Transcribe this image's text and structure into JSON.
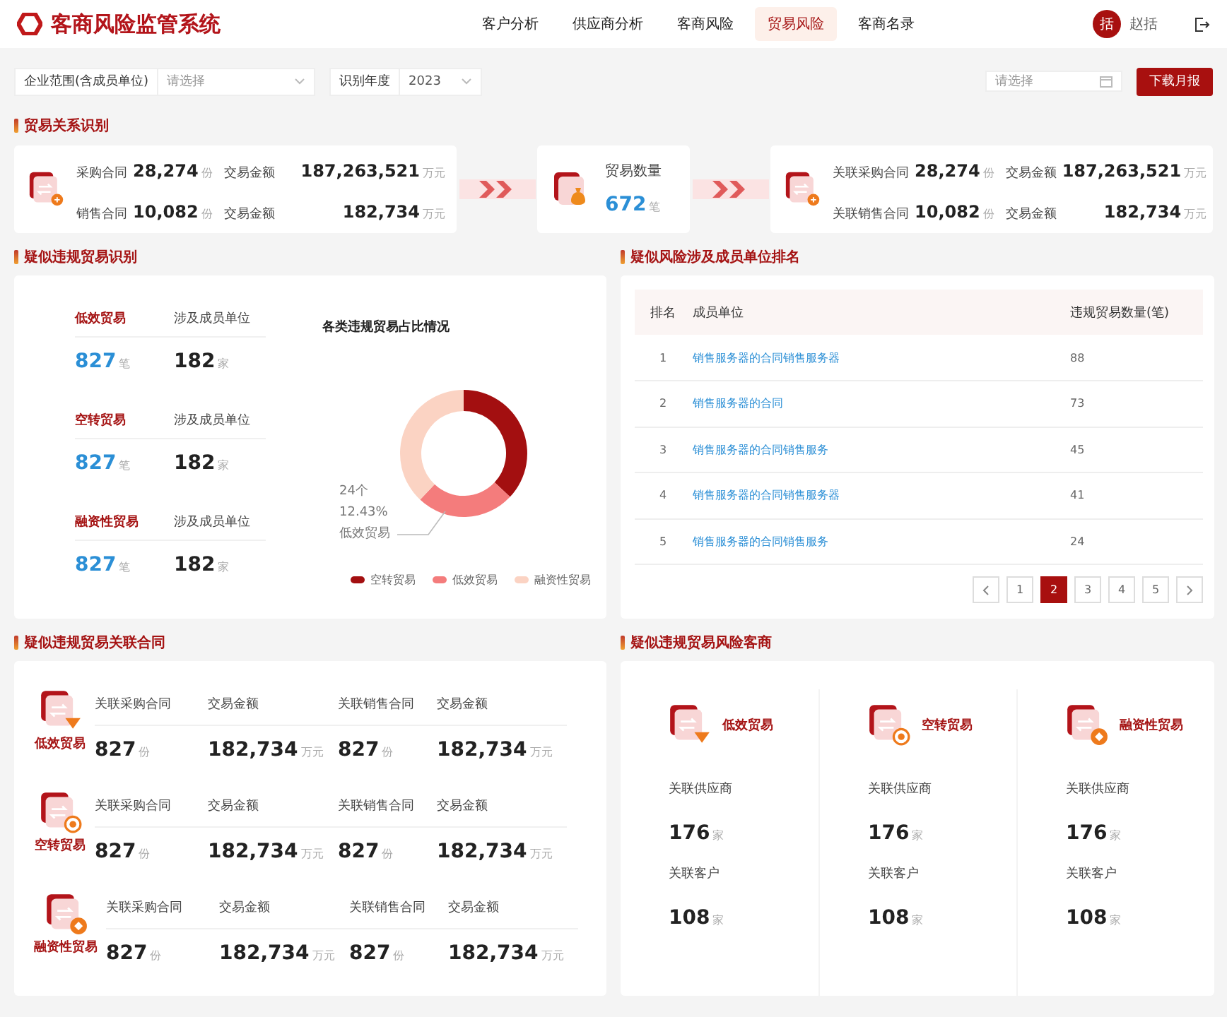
{
  "header": {
    "logo": "客商风险监管系统",
    "nav": [
      {
        "label": "客户分析",
        "selected": false
      },
      {
        "label": "供应商分析",
        "selected": false
      },
      {
        "label": "客商风险",
        "selected": false
      },
      {
        "label": "贸易风险",
        "selected": true
      },
      {
        "label": "客商名录",
        "selected": false
      }
    ],
    "user": {
      "avatar": "括",
      "name": "赵括"
    }
  },
  "filters": {
    "scope": {
      "label": "企业范围(含成员单位)",
      "placeholder": "请选择"
    },
    "year": {
      "label": "识别年度",
      "value": "2023"
    },
    "date": {
      "placeholder": "请选择"
    },
    "download_button": "下载月报"
  },
  "trade_relations": {
    "title": "贸易关系识别",
    "purchase": [
      {
        "label": "采购合同",
        "count": "28,274",
        "count_unit": "份",
        "amount_label": "交易金额",
        "amount": "187,263,521",
        "amount_unit": "万元"
      },
      {
        "label": "销售合同",
        "count": "10,082",
        "count_unit": "份",
        "amount_label": "交易金额",
        "amount": "182,734",
        "amount_unit": "万元"
      }
    ],
    "trade_count": {
      "label": "贸易数量",
      "value": "672",
      "unit": "笔"
    },
    "related": [
      {
        "label": "关联采购合同",
        "count": "28,274",
        "count_unit": "份",
        "amount_label": "交易金额",
        "amount": "187,263,521",
        "amount_unit": "万元"
      },
      {
        "label": "关联销售合同",
        "count": "10,082",
        "count_unit": "份",
        "amount_label": "交易金额",
        "amount": "182,734",
        "amount_unit": "万元"
      }
    ]
  },
  "suspected": {
    "title": "疑似违规贸易识别",
    "items": [
      {
        "type": "低效贸易",
        "count": "827",
        "count_unit": "笔",
        "members_label": "涉及成员单位",
        "members": "182",
        "members_unit": "家"
      },
      {
        "type": "空转贸易",
        "count": "827",
        "count_unit": "笔",
        "members_label": "涉及成员单位",
        "members": "182",
        "members_unit": "家"
      },
      {
        "type": "融资性贸易",
        "count": "827",
        "count_unit": "笔",
        "members_label": "涉及成员单位",
        "members": "182",
        "members_unit": "家"
      }
    ],
    "chart": {
      "title": "各类违规贸易占比情况",
      "callout": [
        "24个",
        "12.43%",
        "低效贸易"
      ],
      "legend": [
        {
          "label": "空转贸易",
          "color": "#a30f10"
        },
        {
          "label": "低效贸易",
          "color": "#f47c7c"
        },
        {
          "label": "融资性贸易",
          "color": "#fbd3c3"
        }
      ]
    }
  },
  "ranking": {
    "title": "疑似风险涉及成员单位排名",
    "columns": [
      "排名",
      "成员单位",
      "违规贸易数量(笔)"
    ],
    "rows": [
      {
        "rank": "1",
        "unit": "销售服务器的合同销售服务器",
        "count": "88"
      },
      {
        "rank": "2",
        "unit": "销售服务器的合同",
        "count": "73"
      },
      {
        "rank": "3",
        "unit": "销售服务器的合同销售服务",
        "count": "45"
      },
      {
        "rank": "4",
        "unit": "销售服务器的合同销售服务器",
        "count": "41"
      },
      {
        "rank": "5",
        "unit": "销售服务器的合同销售服务",
        "count": "24"
      }
    ],
    "pages": [
      {
        "label": "1",
        "selected": false
      },
      {
        "label": "2",
        "selected": true
      },
      {
        "label": "3",
        "selected": false
      },
      {
        "label": "4",
        "selected": false
      },
      {
        "label": "5",
        "selected": false
      }
    ]
  },
  "contracts": {
    "title": "疑似违规贸易关联合同",
    "rows": [
      {
        "kind": "low",
        "label": "低效贸易",
        "cells": [
          {
            "label": "关联采购合同",
            "value": "827",
            "unit": "份"
          },
          {
            "label": "交易金额",
            "value": "182,734",
            "unit": "万元"
          },
          {
            "label": "关联销售合同",
            "value": "827",
            "unit": "份"
          },
          {
            "label": "交易金额",
            "value": "182,734",
            "unit": "万元"
          }
        ]
      },
      {
        "kind": "idle",
        "label": "空转贸易",
        "cells": [
          {
            "label": "关联采购合同",
            "value": "827",
            "unit": "份"
          },
          {
            "label": "交易金额",
            "value": "182,734",
            "unit": "万元"
          },
          {
            "label": "关联销售合同",
            "value": "827",
            "unit": "份"
          },
          {
            "label": "交易金额",
            "value": "182,734",
            "unit": "万元"
          }
        ]
      },
      {
        "kind": "finance",
        "label": "融资性贸易",
        "cells": [
          {
            "label": "关联采购合同",
            "value": "827",
            "unit": "份"
          },
          {
            "label": "交易金额",
            "value": "182,734",
            "unit": "万元"
          },
          {
            "label": "关联销售合同",
            "value": "827",
            "unit": "份"
          },
          {
            "label": "交易金额",
            "value": "182,734",
            "unit": "万元"
          }
        ]
      }
    ]
  },
  "merchants": {
    "title": "疑似违规贸易风险客商",
    "columns": [
      {
        "kind": "low",
        "label": "低效贸易",
        "stats": [
          {
            "label": "关联供应商",
            "value": "176",
            "unit": "家"
          },
          {
            "label": "关联客户",
            "value": "108",
            "unit": "家"
          }
        ]
      },
      {
        "kind": "idle",
        "label": "空转贸易",
        "stats": [
          {
            "label": "关联供应商",
            "value": "176",
            "unit": "家"
          },
          {
            "label": "关联客户",
            "value": "108",
            "unit": "家"
          }
        ]
      },
      {
        "kind": "finance",
        "label": "融资性贸易",
        "stats": [
          {
            "label": "关联供应商",
            "value": "176",
            "unit": "家"
          },
          {
            "label": "关联客户",
            "value": "108",
            "unit": "家"
          }
        ]
      }
    ]
  }
}
